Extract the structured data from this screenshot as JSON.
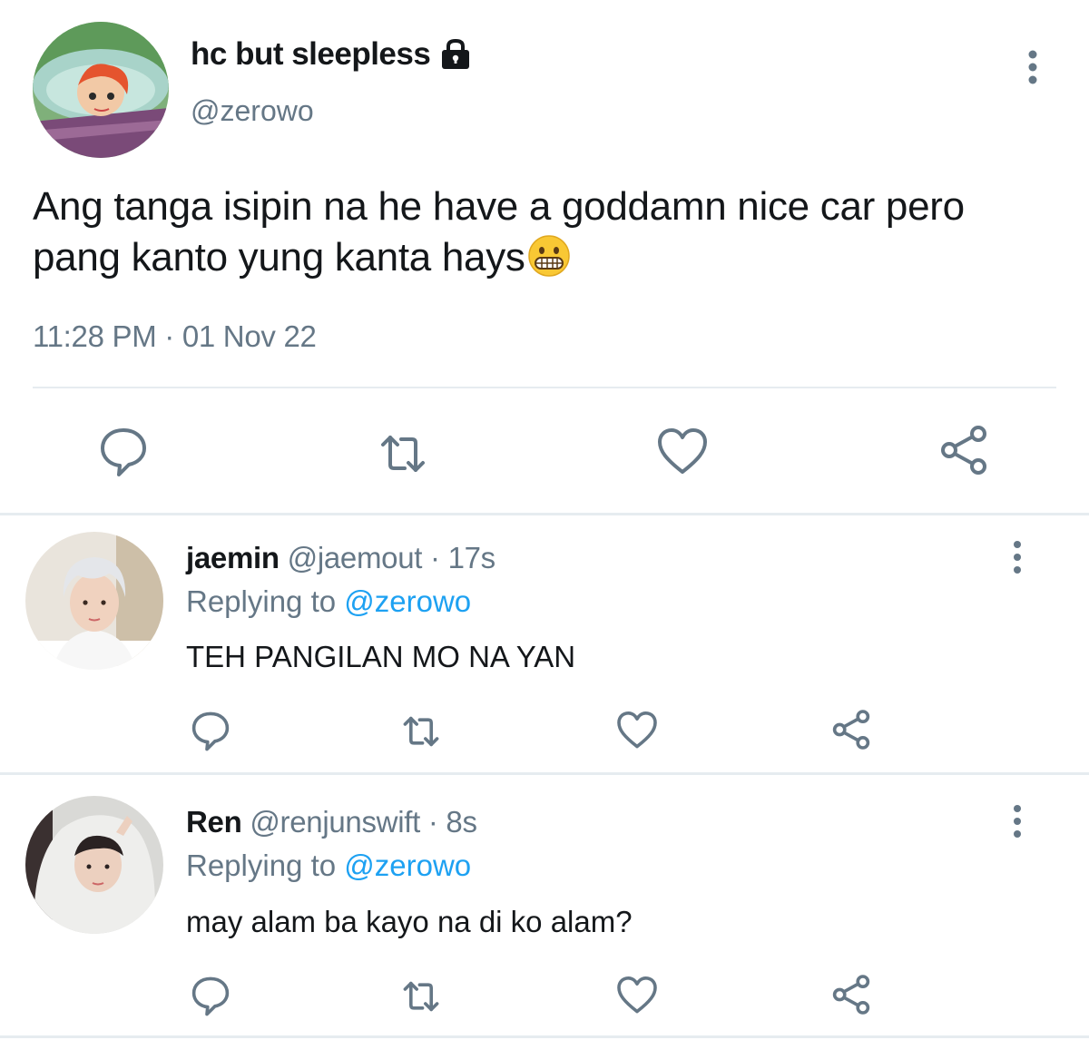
{
  "main_tweet": {
    "display_name": "hc but sleepless",
    "handle": "@zerowo",
    "text": "Ang tanga isipin na he have a goddamn nice car pero pang kanto yung kanta hays",
    "timestamp": "11:28 PM · 01 Nov 22"
  },
  "replies": [
    {
      "display_name": "jaemin",
      "handle": "@jaemout",
      "time": "· 17s",
      "replying_label": "Replying to",
      "replying_to": "@zerowo",
      "text": "TEH PANGILAN MO NA YAN"
    },
    {
      "display_name": "Ren",
      "handle": "@renjunswift",
      "time": "· 8s",
      "replying_label": "Replying to",
      "replying_to": "@zerowo",
      "text": "may alam ba kayo na di ko alam?"
    }
  ],
  "icons": {
    "lock": "lock-icon",
    "more": "more-vertical-icon",
    "reply": "reply-icon",
    "retweet": "retweet-icon",
    "like": "heart-icon",
    "share": "share-icon",
    "emoji": "grimacing-face-emoji"
  },
  "colors": {
    "text_primary": "#14171a",
    "text_secondary": "#657786",
    "mention": "#1da1f2",
    "divider": "#e6ecf0"
  }
}
